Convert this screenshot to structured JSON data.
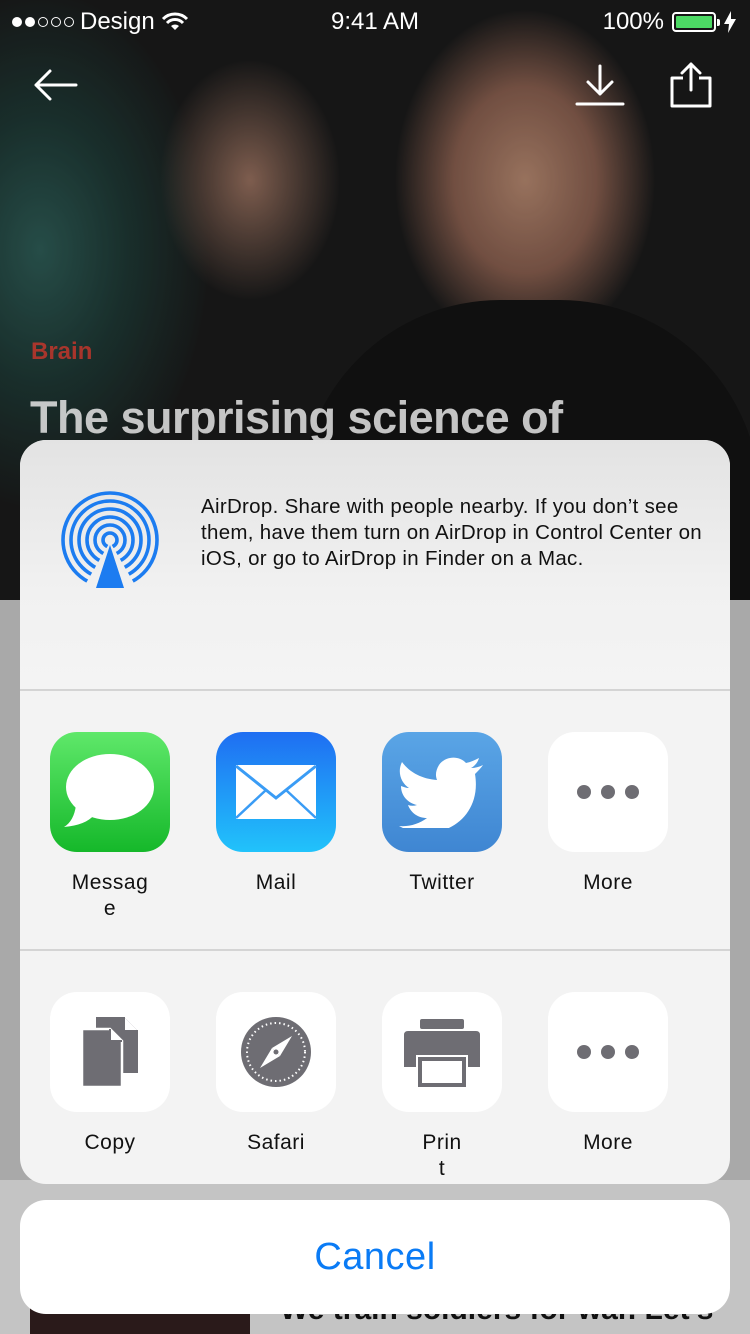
{
  "status_bar": {
    "carrier": "Design",
    "time": "9:41 AM",
    "battery": "100%"
  },
  "hero": {
    "category": "Brain",
    "title": "The surprising science of"
  },
  "next_article": {
    "title": "We train soldiers for war. Let's"
  },
  "share_sheet": {
    "airdrop_text": "AirDrop. Share with people nearby. If you don’t see them, have them turn on AirDrop in Control Center on iOS, or go to AirDrop in Finder on a Mac.",
    "apps": [
      {
        "label": "Messag\ne",
        "icon": "messages-icon"
      },
      {
        "label": "Mail",
        "icon": "mail-icon"
      },
      {
        "label": "Twitter",
        "icon": "twitter-icon"
      },
      {
        "label": "More",
        "icon": "more-icon"
      }
    ],
    "actions": [
      {
        "label": "Copy",
        "icon": "copy-icon"
      },
      {
        "label": "Safari",
        "icon": "safari-icon"
      },
      {
        "label": "Prin\nt",
        "icon": "print-icon"
      },
      {
        "label": "More",
        "icon": "more-icon"
      }
    ],
    "cancel_label": "Cancel"
  },
  "colors": {
    "accent": "#0a7bf5",
    "category_red": "#d8362b",
    "messages_green": "#2bc840",
    "mail_blue": "#1a8cf5",
    "twitter_blue": "#4a95da"
  }
}
